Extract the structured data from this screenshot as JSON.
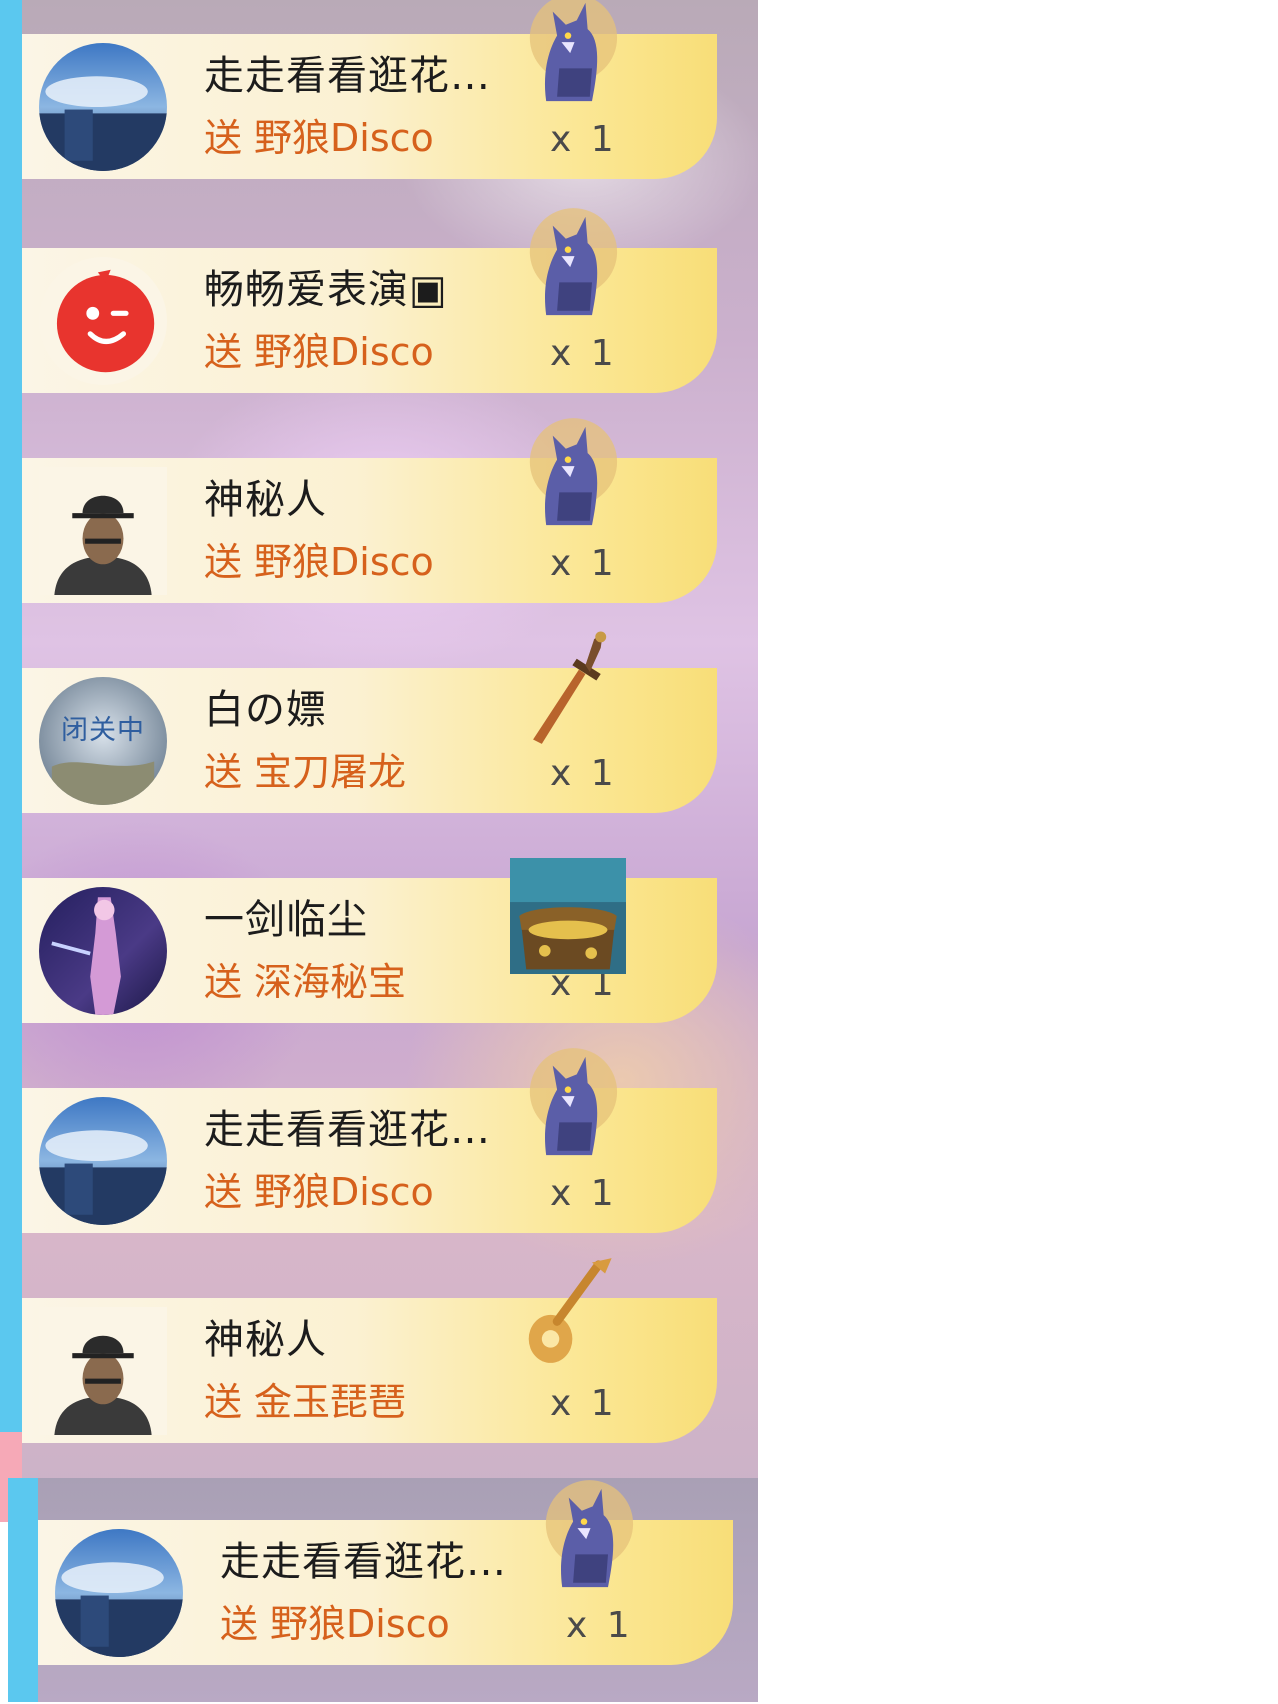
{
  "gift_feed": {
    "items": [
      {
        "username": "走走看看逛花…",
        "send_word": "送",
        "gift_name": "野狼Disco",
        "count": "x 1",
        "avatar_icon": "sky-landscape-avatar",
        "gift_icon": "purple-wolf-gift-icon"
      },
      {
        "username": "畅畅爱表演▣",
        "send_word": "送",
        "gift_name": "野狼Disco",
        "count": "x 1",
        "avatar_icon": "red-wink-face-avatar",
        "gift_icon": "purple-wolf-gift-icon"
      },
      {
        "username": "神秘人",
        "send_word": "送",
        "gift_name": "野狼Disco",
        "count": "x 1",
        "avatar_icon": "mystery-man-hat-avatar",
        "gift_icon": "purple-wolf-gift-icon"
      },
      {
        "username": "白の嫖",
        "send_word": "送",
        "gift_name": "宝刀屠龙",
        "count": "x 1",
        "avatar_icon": "closed-sign-avatar",
        "avatar_text": "闭关中",
        "gift_icon": "dragon-sword-gift-icon"
      },
      {
        "username": "一剑临尘",
        "send_word": "送",
        "gift_name": "深海秘宝",
        "count": "x 1",
        "avatar_icon": "purple-warrior-avatar",
        "gift_icon": "treasure-chest-gift-icon"
      },
      {
        "username": "走走看看逛花…",
        "send_word": "送",
        "gift_name": "野狼Disco",
        "count": "x 1",
        "avatar_icon": "sky-landscape-avatar",
        "gift_icon": "purple-wolf-gift-icon"
      },
      {
        "username": "神秘人",
        "send_word": "送",
        "gift_name": "金玉琵琶",
        "count": "x 1",
        "avatar_icon": "mystery-man-hat-avatar",
        "gift_icon": "golden-pipa-gift-icon"
      },
      {
        "username": "走走看看逛花…",
        "send_word": "送",
        "gift_name": "野狼Disco",
        "count": "x 1",
        "avatar_icon": "sky-landscape-avatar",
        "gift_icon": "purple-wolf-gift-icon"
      }
    ]
  },
  "colors": {
    "gift_text": "#d6611c",
    "username_text": "#1c1c1c",
    "side_strip": "#5bc8ef",
    "row_highlight": "#f8de78"
  }
}
